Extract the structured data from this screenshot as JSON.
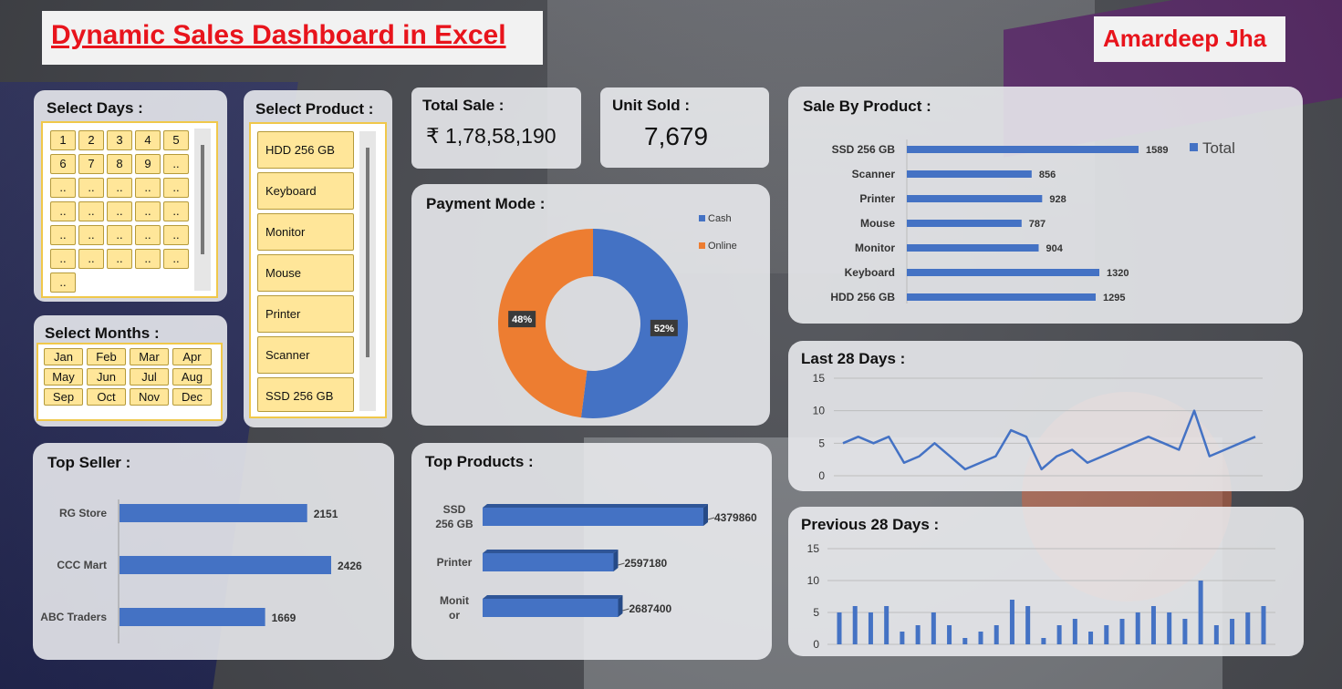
{
  "header": {
    "title": "Dynamic Sales Dashboard in Excel",
    "author": "Amardeep Jha"
  },
  "days_slicer": {
    "title": "Select Days :",
    "items": [
      "1",
      "2",
      "3",
      "4",
      "5",
      "6",
      "7",
      "8",
      "9",
      "..",
      "..",
      "..",
      "..",
      "..",
      "..",
      "..",
      "..",
      "..",
      "..",
      "..",
      "..",
      "..",
      "..",
      "..",
      "..",
      "..",
      "..",
      "..",
      "..",
      "..",
      ".."
    ]
  },
  "months_slicer": {
    "title": "Select Months :",
    "items": [
      "Jan",
      "Feb",
      "Mar",
      "Apr",
      "May",
      "Jun",
      "Jul",
      "Aug",
      "Sep",
      "Oct",
      "Nov",
      "Dec"
    ]
  },
  "product_slicer": {
    "title": "Select Product :",
    "items": [
      "HDD 256 GB",
      "Keyboard",
      "Monitor",
      "Mouse",
      "Printer",
      "Scanner",
      "SSD 256 GB"
    ]
  },
  "kpi": {
    "total_sale_label": "Total Sale :",
    "total_sale_value": "₹ 1,78,58,190",
    "unit_sold_label": "Unit Sold :",
    "unit_sold_value": "7,679"
  },
  "payment": {
    "title": "Payment Mode :",
    "colors": {
      "Cash": "#4472c4",
      "Online": "#ed7d31"
    }
  },
  "sale_by_product": {
    "title": "Sale By Product :",
    "bar_color": "#4472c4"
  },
  "top_seller": {
    "title": "Top Seller :"
  },
  "top_products": {
    "title": "Top Products :"
  },
  "last28": {
    "title": "Last 28 Days :"
  },
  "prev28": {
    "title": "Previous 28 Days :"
  },
  "chart_data": [
    {
      "id": "payment_mode",
      "type": "pie",
      "labels": [
        "Cash",
        "Online"
      ],
      "values": [
        52,
        48
      ],
      "data_labels": [
        "52%",
        "48%"
      ],
      "legend": "top-right"
    },
    {
      "id": "sale_by_product",
      "type": "bar",
      "orientation": "horizontal",
      "categories": [
        "SSD 256 GB",
        "Scanner",
        "Printer",
        "Mouse",
        "Monitor",
        "Keyboard",
        "HDD 256 GB"
      ],
      "series": [
        {
          "name": "Total",
          "values": [
            1589,
            856,
            928,
            787,
            904,
            1320,
            1295
          ]
        }
      ],
      "legend": "top-right"
    },
    {
      "id": "top_seller",
      "type": "bar",
      "orientation": "horizontal",
      "categories": [
        "RG Store",
        "CCC Mart",
        "ABC Traders"
      ],
      "values": [
        2151,
        2426,
        1669
      ]
    },
    {
      "id": "top_products",
      "type": "bar",
      "orientation": "horizontal",
      "categories": [
        "SSD 256 GB",
        "Printer",
        "Monitor"
      ],
      "category_lines": [
        [
          "SSD",
          "256 GB"
        ],
        [
          "Printer"
        ],
        [
          "Monit",
          "or"
        ]
      ],
      "values": [
        4379860,
        2597180,
        2687400
      ]
    },
    {
      "id": "last_28_days",
      "type": "line",
      "y_ticks": [
        0,
        5,
        10,
        15
      ],
      "ylim": [
        0,
        15
      ],
      "grid": true,
      "values": [
        5,
        6,
        5,
        6,
        2,
        3,
        5,
        3,
        1,
        2,
        3,
        7,
        6,
        1,
        3,
        4,
        2,
        3,
        4,
        5,
        6,
        5,
        4,
        10,
        3,
        4,
        5,
        6
      ]
    },
    {
      "id": "previous_28_days",
      "type": "bar",
      "y_ticks": [
        0,
        5,
        10,
        15
      ],
      "ylim": [
        0,
        15
      ],
      "grid": true,
      "values": [
        5,
        6,
        5,
        6,
        2,
        3,
        5,
        3,
        1,
        2,
        3,
        7,
        6,
        1,
        3,
        4,
        2,
        3,
        4,
        5,
        6,
        5,
        4,
        10,
        3,
        4,
        5,
        6
      ]
    }
  ]
}
